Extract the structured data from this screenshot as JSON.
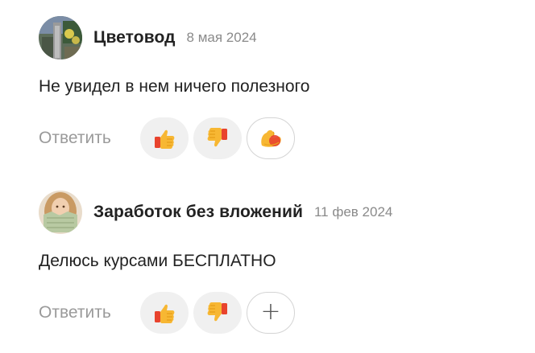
{
  "comments": [
    {
      "author": "Цветовод",
      "date": "8 мая 2024",
      "text": "Не увидел в нем ничего полезного",
      "reply_label": "Ответить",
      "avatar_icon": "garden-photo-avatar",
      "reactions": [
        "thumbs-up-icon",
        "thumbs-down-icon",
        "flexed-biceps-icon"
      ]
    },
    {
      "author": "Заработок без вложений",
      "date": "11 фев 2024",
      "text": "Делюсь курсами БЕСПЛАТНО",
      "reply_label": "Ответить",
      "avatar_icon": "woman-with-money-avatar",
      "reactions": [
        "thumbs-up-icon",
        "thumbs-down-icon"
      ],
      "add_reaction_symbol": "+"
    }
  ],
  "colors": {
    "reaction_bg": "#f0f0f0",
    "muted_text": "#9a9a9a",
    "date_text": "#8a8a8a",
    "emoji_yellow": "#f7b733",
    "emoji_orange": "#e8a21c",
    "cuff_red": "#e8432d"
  }
}
